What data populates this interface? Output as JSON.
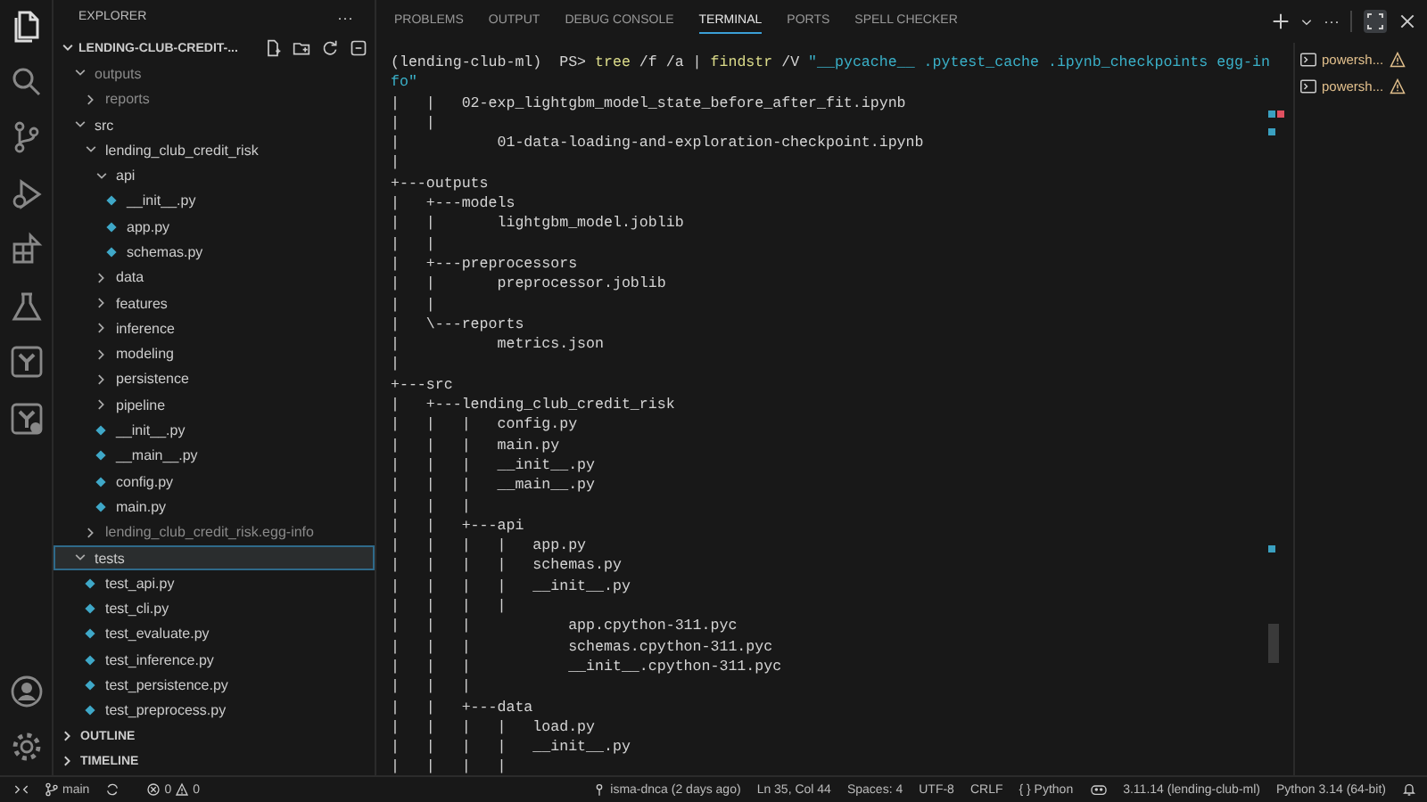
{
  "explorer": {
    "title": "EXPLORER",
    "more": "···",
    "root": {
      "label": "LENDING-CLUB-CREDIT-...",
      "expanded": true
    },
    "tree": [
      {
        "label": "outputs",
        "kind": "folder",
        "expanded": true,
        "dimmed": true,
        "selected": false,
        "children": [
          {
            "label": "reports",
            "kind": "folder",
            "expanded": false,
            "dimmed": true,
            "selected": false
          }
        ]
      },
      {
        "label": "src",
        "kind": "folder",
        "expanded": true,
        "dimmed": false,
        "selected": false,
        "children": [
          {
            "label": "lending_club_credit_risk",
            "kind": "folder",
            "expanded": true,
            "dimmed": false,
            "selected": false,
            "children": [
              {
                "label": "api",
                "kind": "folder",
                "expanded": true,
                "dimmed": false,
                "selected": false,
                "children": [
                  {
                    "label": "__init__.py",
                    "kind": "file",
                    "dimmed": false,
                    "selected": false
                  },
                  {
                    "label": "app.py",
                    "kind": "file",
                    "dimmed": false,
                    "selected": false
                  },
                  {
                    "label": "schemas.py",
                    "kind": "file",
                    "dimmed": false,
                    "selected": false
                  }
                ]
              },
              {
                "label": "data",
                "kind": "folder",
                "expanded": false,
                "dimmed": false,
                "selected": false
              },
              {
                "label": "features",
                "kind": "folder",
                "expanded": false,
                "dimmed": false,
                "selected": false
              },
              {
                "label": "inference",
                "kind": "folder",
                "expanded": false,
                "dimmed": false,
                "selected": false
              },
              {
                "label": "modeling",
                "kind": "folder",
                "expanded": false,
                "dimmed": false,
                "selected": false
              },
              {
                "label": "persistence",
                "kind": "folder",
                "expanded": false,
                "dimmed": false,
                "selected": false
              },
              {
                "label": "pipeline",
                "kind": "folder",
                "expanded": false,
                "dimmed": false,
                "selected": false
              },
              {
                "label": "__init__.py",
                "kind": "file",
                "dimmed": false,
                "selected": false
              },
              {
                "label": "__main__.py",
                "kind": "file",
                "dimmed": false,
                "selected": false
              },
              {
                "label": "config.py",
                "kind": "file",
                "dimmed": false,
                "selected": false
              },
              {
                "label": "main.py",
                "kind": "file",
                "dimmed": false,
                "selected": false
              }
            ]
          },
          {
            "label": "lending_club_credit_risk.egg-info",
            "kind": "folder",
            "expanded": false,
            "dimmed": true,
            "selected": false
          }
        ]
      },
      {
        "label": "tests",
        "kind": "folder",
        "expanded": true,
        "dimmed": false,
        "selected": true,
        "children": [
          {
            "label": "test_api.py",
            "kind": "file",
            "dimmed": false,
            "selected": false
          },
          {
            "label": "test_cli.py",
            "kind": "file",
            "dimmed": false,
            "selected": false
          },
          {
            "label": "test_evaluate.py",
            "kind": "file",
            "dimmed": false,
            "selected": false
          },
          {
            "label": "test_inference.py",
            "kind": "file",
            "dimmed": false,
            "selected": false
          },
          {
            "label": "test_persistence.py",
            "kind": "file",
            "dimmed": false,
            "selected": false
          },
          {
            "label": "test_preprocess.py",
            "kind": "file",
            "dimmed": false,
            "selected": false
          }
        ]
      }
    ],
    "sections": [
      {
        "label": "OUTLINE",
        "expanded": false
      },
      {
        "label": "TIMELINE",
        "expanded": false
      }
    ]
  },
  "panel": {
    "tabs": [
      {
        "label": "PROBLEMS",
        "selected": false
      },
      {
        "label": "OUTPUT",
        "selected": false
      },
      {
        "label": "DEBUG CONSOLE",
        "selected": false
      },
      {
        "label": "TERMINAL",
        "selected": true
      },
      {
        "label": "PORTS",
        "selected": false
      },
      {
        "label": "SPELL CHECKER",
        "selected": false
      }
    ],
    "more": "···",
    "terminals": [
      {
        "label": "powersh..."
      },
      {
        "label": "powersh..."
      }
    ]
  },
  "terminal": {
    "command": [
      {
        "text": "(lending-club-ml)  PS> ",
        "kind": "prompt"
      },
      {
        "text": "tree",
        "kind": "cmd"
      },
      {
        "text": " /f /a | ",
        "kind": "arg"
      },
      {
        "text": "findstr",
        "kind": "cmd"
      },
      {
        "text": " /V ",
        "kind": "arg"
      },
      {
        "text": "\"__pycache__ .pytest_cache .ipynb_checkpoints egg-in",
        "kind": "string"
      }
    ],
    "command_wrap": [
      {
        "text": "fo\"",
        "kind": "string"
      }
    ],
    "output": [
      "|   |   02-exp_lightgbm_model_state_before_after_fit.ipynb",
      "|   |",
      "|           01-data-loading-and-exploration-checkpoint.ipynb",
      "|",
      "+---outputs",
      "|   +---models",
      "|   |       lightgbm_model.joblib",
      "|   |",
      "|   +---preprocessors",
      "|   |       preprocessor.joblib",
      "|   |",
      "|   \\---reports",
      "|           metrics.json",
      "|",
      "+---src",
      "|   +---lending_club_credit_risk",
      "|   |   |   config.py",
      "|   |   |   main.py",
      "|   |   |   __init__.py",
      "|   |   |   __main__.py",
      "|   |   |",
      "|   |   +---api",
      "|   |   |   |   app.py",
      "|   |   |   |   schemas.py",
      "|   |   |   |   __init__.py",
      "|   |   |   |",
      "|   |   |           app.cpython-311.pyc",
      "|   |   |           schemas.cpython-311.pyc",
      "|   |   |           __init__.cpython-311.pyc",
      "|   |   |",
      "|   |   +---data",
      "|   |   |   |   load.py",
      "|   |   |   |   __init__.py",
      "|   |   |   |"
    ]
  },
  "status": {
    "branch": "main",
    "errors": "0",
    "warnings": "0",
    "right": [
      {
        "text": "isma-dnca (2 days ago)",
        "kind": "blame"
      },
      {
        "text": "Ln 35, Col 44",
        "kind": "text"
      },
      {
        "text": "Spaces: 4",
        "kind": "text"
      },
      {
        "text": "UTF-8",
        "kind": "text"
      },
      {
        "text": "CRLF",
        "kind": "text"
      },
      {
        "text": "{ } Python",
        "kind": "text"
      },
      {
        "kind": "copilot"
      },
      {
        "text": "3.11.14 (lending-club-ml)",
        "kind": "text"
      },
      {
        "text": "Python 3.14 (64-bit)",
        "kind": "text"
      },
      {
        "kind": "bell"
      }
    ]
  }
}
